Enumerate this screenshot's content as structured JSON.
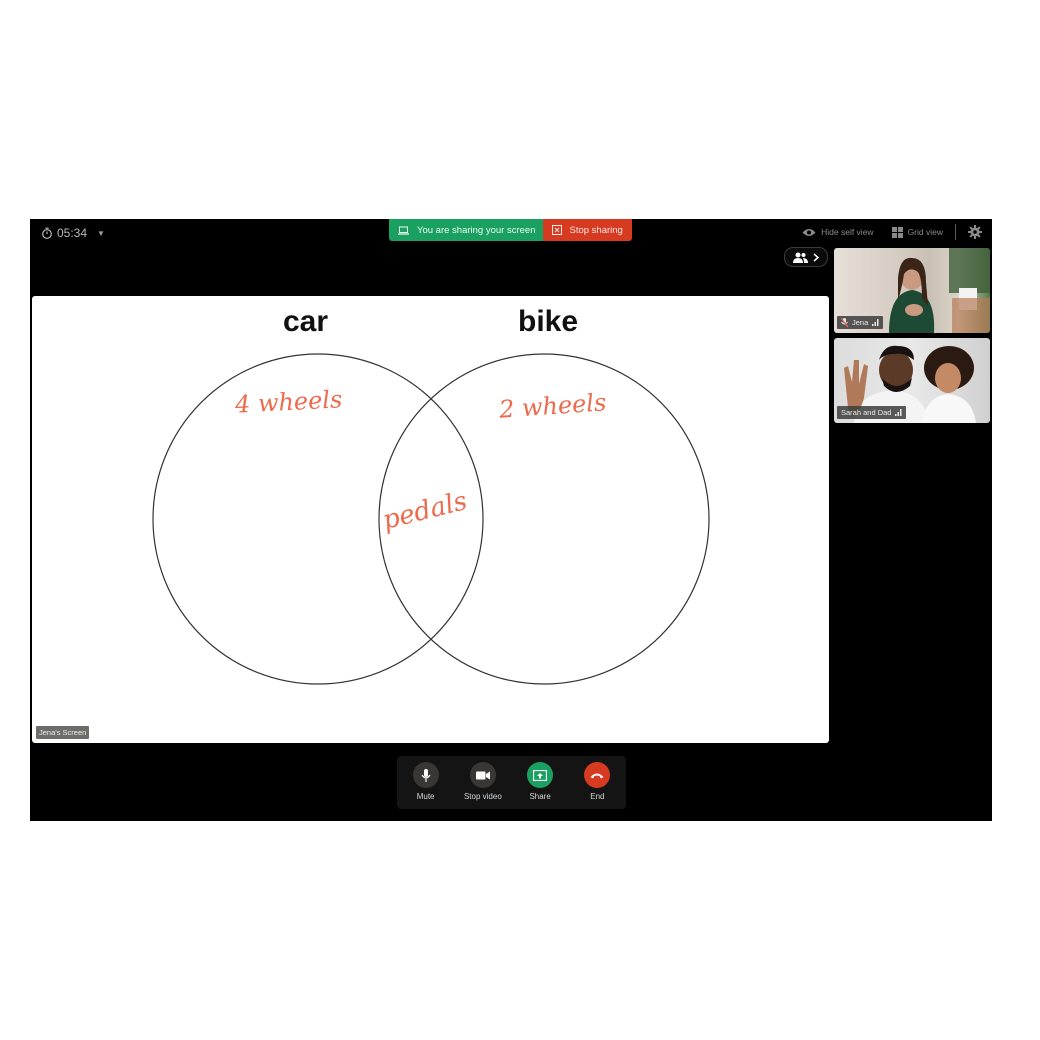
{
  "topbar": {
    "timer": "05:34",
    "sharing_status": "You are sharing your screen",
    "stop_sharing": "Stop sharing",
    "hide_self_view": "Hide self view",
    "grid_view": "Grid view"
  },
  "whiteboard": {
    "label": "Jena's Screen",
    "venn": {
      "left_title": "car",
      "right_title": "bike",
      "left_note": "4 wheels",
      "right_note": "2 wheels",
      "overlap_note": "pedals"
    },
    "colors": {
      "ink": "#ee6a4c",
      "outline": "#333333"
    }
  },
  "participants": [
    {
      "name": "Jena",
      "muted": true
    },
    {
      "name": "Sarah and Dad",
      "muted": false
    }
  ],
  "controls": [
    {
      "id": "mute",
      "label": "Mute"
    },
    {
      "id": "stop-video",
      "label": "Stop video"
    },
    {
      "id": "share",
      "label": "Share"
    },
    {
      "id": "end",
      "label": "End"
    }
  ],
  "colors": {
    "share_green": "#1aa060",
    "stop_red": "#d63a20",
    "control_gray": "#3a3633",
    "end_red": "#d63a20"
  }
}
